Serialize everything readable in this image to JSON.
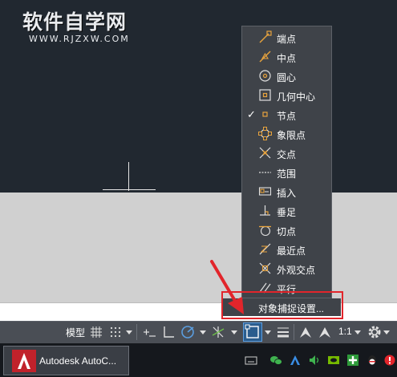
{
  "watermark": {
    "title": "软件自学网",
    "url": "WWW.RJZXW.COM"
  },
  "snap_menu": {
    "items": [
      {
        "label": "端点",
        "icon": "endpoint-icon",
        "checked": false
      },
      {
        "label": "中点",
        "icon": "midpoint-icon",
        "checked": false
      },
      {
        "label": "圆心",
        "icon": "center-icon",
        "checked": false
      },
      {
        "label": "几何中心",
        "icon": "geometric-center-icon",
        "checked": false
      },
      {
        "label": "节点",
        "icon": "node-icon",
        "checked": true
      },
      {
        "label": "象限点",
        "icon": "quadrant-icon",
        "checked": false
      },
      {
        "label": "交点",
        "icon": "intersection-icon",
        "checked": false
      },
      {
        "label": "范围",
        "icon": "extension-icon",
        "checked": false
      },
      {
        "label": "插入",
        "icon": "insertion-icon",
        "checked": false
      },
      {
        "label": "垂足",
        "icon": "perpendicular-icon",
        "checked": false
      },
      {
        "label": "切点",
        "icon": "tangent-icon",
        "checked": false
      },
      {
        "label": "最近点",
        "icon": "nearest-icon",
        "checked": false
      },
      {
        "label": "外观交点",
        "icon": "apparent-intersection-icon",
        "checked": false
      },
      {
        "label": "平行",
        "icon": "parallel-icon",
        "checked": false
      }
    ],
    "check_mark": "✓",
    "settings_label": "对象捕捉设置..."
  },
  "status_bar": {
    "model_label": "模型",
    "scale_label": "1:1"
  },
  "taskbar": {
    "app_label": "Autodesk AutoC..."
  },
  "colors": {
    "menu_bg": "#3f4349",
    "icon_orange": "#e8a33d",
    "highlight_red": "#e2252b",
    "active_blue": "#2b5d8e"
  }
}
